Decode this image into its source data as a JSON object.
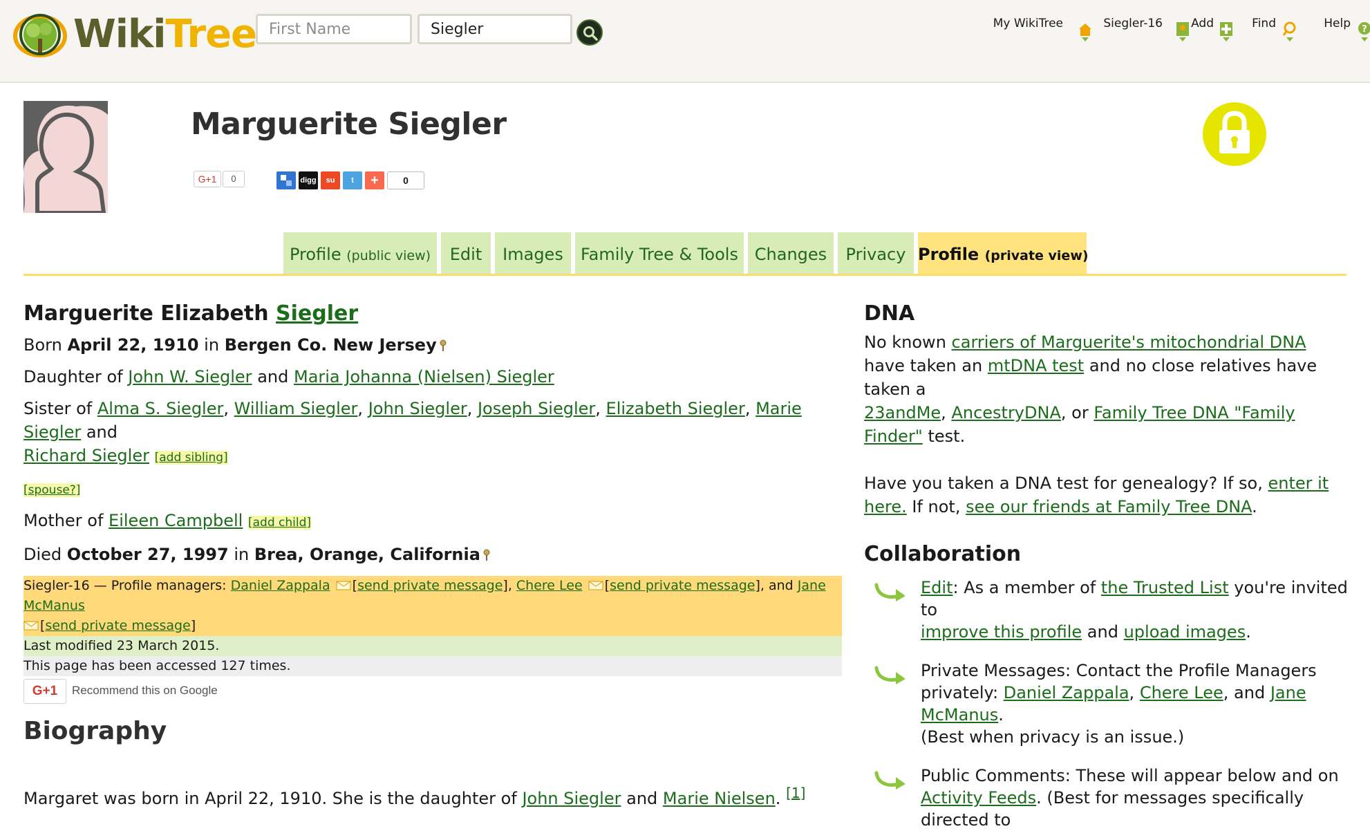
{
  "header": {
    "logo_text_left": "Wiki",
    "logo_text_right": "Tree",
    "first_name_placeholder": "First Name",
    "last_name_value": "Siegler",
    "nav": [
      {
        "label": "My WikiTree",
        "icon": "home-icon"
      },
      {
        "label": "Siegler-16",
        "icon": "profile-icon"
      },
      {
        "label": "Add",
        "icon": "add-icon"
      },
      {
        "label": "Find",
        "icon": "find-icon"
      },
      {
        "label": "Help",
        "icon": "help-icon"
      }
    ]
  },
  "profile": {
    "title": "Marguerite Siegler",
    "gplus_label": "G+1",
    "gplus_count": "0",
    "share_icons": [
      {
        "name": "delicious",
        "color": "#3274d2",
        "text": ""
      },
      {
        "name": "digg",
        "color": "#111111",
        "text": "digg"
      },
      {
        "name": "stumbleupon",
        "color": "#eb4924",
        "text": "su"
      },
      {
        "name": "twitter",
        "color": "#4ca3e0",
        "text": "t"
      },
      {
        "name": "addthis",
        "color": "#f8694d",
        "text": "+"
      }
    ],
    "share_count": "0"
  },
  "tabs": [
    {
      "label": "Profile",
      "small": "(public view)",
      "active": false
    },
    {
      "label": "Edit",
      "small": "",
      "active": false
    },
    {
      "label": "Images",
      "small": "",
      "active": false
    },
    {
      "label": "Family Tree & Tools",
      "small": "",
      "active": false
    },
    {
      "label": "Changes",
      "small": "",
      "active": false
    },
    {
      "label": "Privacy",
      "small": "",
      "active": false
    },
    {
      "label": "Profile",
      "small": "(private view)",
      "active": true
    }
  ],
  "person": {
    "given_names": "Marguerite Elizabeth",
    "surname": "Siegler",
    "born_prefix": "Born",
    "born_date": "April 22, 1910",
    "in": "in",
    "born_place": "Bergen Co. New Jersey",
    "daughter_of": "Daughter of",
    "father": "John W. Siegler",
    "and": "and",
    "mother": "Maria Johanna (Nielsen) Siegler",
    "sister_of": "Sister of",
    "siblings": [
      "Alma S. Siegler",
      "William Siegler",
      "John Siegler",
      "Joseph Siegler",
      "Elizabeth Siegler",
      "Marie Siegler",
      "Richard Siegler"
    ],
    "add_sibling": "[add sibling]",
    "spouse": "[spouse?]",
    "mother_of": "Mother of",
    "child": "Eileen Campbell",
    "add_child": "[add child]",
    "died_prefix": "Died",
    "died_date": "October 27, 1997",
    "died_place": "Brea, Orange, California"
  },
  "managers": {
    "prefix": "Siegler-16 — Profile managers:",
    "names": [
      "Daniel Zappala",
      "Chere Lee",
      "Jane McManus"
    ],
    "send_pm": "send private message",
    "and": "and",
    "modified": "Last modified 23 March 2015.",
    "accessed": "This page has been accessed 127 times."
  },
  "recommend": {
    "button": "G+1",
    "text": "Recommend this on Google"
  },
  "biography": {
    "heading": "Biography",
    "text_start": "Margaret was born in April 22, 1910. She is the daughter of",
    "father_link": "John Siegler",
    "and": "and",
    "mother_link": "Marie Nielsen",
    "ref": "[1]"
  },
  "dna": {
    "heading": "DNA",
    "t1": "No known",
    "l1": "carriers of Marguerite's mitochondrial DNA",
    "t2": "have taken an",
    "l2": "mtDNA test",
    "t3": "and no close relatives have taken a",
    "l3": "23andMe",
    "l4": "AncestryDNA",
    "t4": ", or",
    "l5": "Family Tree DNA \"Family Finder\"",
    "t5": "test.",
    "q1": "Have you taken a DNA test for genealogy? If so,",
    "ql1": "enter it here.",
    "q2": "If not,",
    "ql2": "see our friends at Family Tree DNA",
    "q3": "."
  },
  "collaboration": {
    "heading": "Collaboration",
    "edit_link": "Edit",
    "edit_t1": ": As a member of",
    "trusted_link": "the Trusted List",
    "edit_t2": "you're invited to",
    "improve_link": "improve this profile",
    "edit_t3": "and",
    "upload_link": "upload images",
    "edit_t4": ".",
    "pm_t1": "Private Messages: Contact the Profile Managers privately:",
    "pm_names": [
      "Daniel Zappala",
      "Chere Lee",
      "Jane McManus"
    ],
    "pm_and": ", and",
    "pm_t2": ".",
    "pm_t3": "(Best when privacy is an issue.)",
    "pc_t1": "Public Comments: These will appear below and on",
    "pc_link": "Activity Feeds",
    "pc_t2": ". (Best for messages specifically directed to"
  },
  "colors": {
    "tab_bg": "#d7ecb7",
    "tab_active_bg": "#ffe37f",
    "link": "#1b6d1b",
    "manager_bg": "#ffd97a",
    "lock": "#e6e500"
  }
}
